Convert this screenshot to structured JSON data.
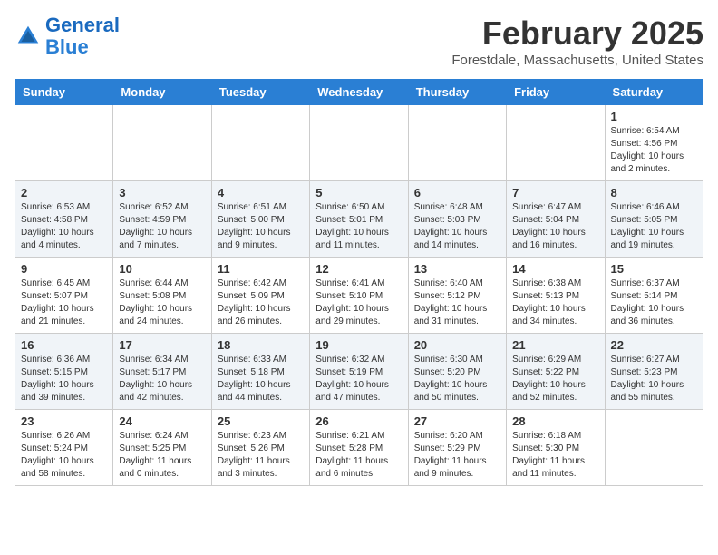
{
  "header": {
    "logo_line1": "General",
    "logo_line2": "Blue",
    "month": "February 2025",
    "location": "Forestdale, Massachusetts, United States"
  },
  "days_of_week": [
    "Sunday",
    "Monday",
    "Tuesday",
    "Wednesday",
    "Thursday",
    "Friday",
    "Saturday"
  ],
  "weeks": [
    {
      "shade": false,
      "days": [
        {
          "num": "",
          "info": ""
        },
        {
          "num": "",
          "info": ""
        },
        {
          "num": "",
          "info": ""
        },
        {
          "num": "",
          "info": ""
        },
        {
          "num": "",
          "info": ""
        },
        {
          "num": "",
          "info": ""
        },
        {
          "num": "1",
          "info": "Sunrise: 6:54 AM\nSunset: 4:56 PM\nDaylight: 10 hours and 2 minutes."
        }
      ]
    },
    {
      "shade": true,
      "days": [
        {
          "num": "2",
          "info": "Sunrise: 6:53 AM\nSunset: 4:58 PM\nDaylight: 10 hours and 4 minutes."
        },
        {
          "num": "3",
          "info": "Sunrise: 6:52 AM\nSunset: 4:59 PM\nDaylight: 10 hours and 7 minutes."
        },
        {
          "num": "4",
          "info": "Sunrise: 6:51 AM\nSunset: 5:00 PM\nDaylight: 10 hours and 9 minutes."
        },
        {
          "num": "5",
          "info": "Sunrise: 6:50 AM\nSunset: 5:01 PM\nDaylight: 10 hours and 11 minutes."
        },
        {
          "num": "6",
          "info": "Sunrise: 6:48 AM\nSunset: 5:03 PM\nDaylight: 10 hours and 14 minutes."
        },
        {
          "num": "7",
          "info": "Sunrise: 6:47 AM\nSunset: 5:04 PM\nDaylight: 10 hours and 16 minutes."
        },
        {
          "num": "8",
          "info": "Sunrise: 6:46 AM\nSunset: 5:05 PM\nDaylight: 10 hours and 19 minutes."
        }
      ]
    },
    {
      "shade": false,
      "days": [
        {
          "num": "9",
          "info": "Sunrise: 6:45 AM\nSunset: 5:07 PM\nDaylight: 10 hours and 21 minutes."
        },
        {
          "num": "10",
          "info": "Sunrise: 6:44 AM\nSunset: 5:08 PM\nDaylight: 10 hours and 24 minutes."
        },
        {
          "num": "11",
          "info": "Sunrise: 6:42 AM\nSunset: 5:09 PM\nDaylight: 10 hours and 26 minutes."
        },
        {
          "num": "12",
          "info": "Sunrise: 6:41 AM\nSunset: 5:10 PM\nDaylight: 10 hours and 29 minutes."
        },
        {
          "num": "13",
          "info": "Sunrise: 6:40 AM\nSunset: 5:12 PM\nDaylight: 10 hours and 31 minutes."
        },
        {
          "num": "14",
          "info": "Sunrise: 6:38 AM\nSunset: 5:13 PM\nDaylight: 10 hours and 34 minutes."
        },
        {
          "num": "15",
          "info": "Sunrise: 6:37 AM\nSunset: 5:14 PM\nDaylight: 10 hours and 36 minutes."
        }
      ]
    },
    {
      "shade": true,
      "days": [
        {
          "num": "16",
          "info": "Sunrise: 6:36 AM\nSunset: 5:15 PM\nDaylight: 10 hours and 39 minutes."
        },
        {
          "num": "17",
          "info": "Sunrise: 6:34 AM\nSunset: 5:17 PM\nDaylight: 10 hours and 42 minutes."
        },
        {
          "num": "18",
          "info": "Sunrise: 6:33 AM\nSunset: 5:18 PM\nDaylight: 10 hours and 44 minutes."
        },
        {
          "num": "19",
          "info": "Sunrise: 6:32 AM\nSunset: 5:19 PM\nDaylight: 10 hours and 47 minutes."
        },
        {
          "num": "20",
          "info": "Sunrise: 6:30 AM\nSunset: 5:20 PM\nDaylight: 10 hours and 50 minutes."
        },
        {
          "num": "21",
          "info": "Sunrise: 6:29 AM\nSunset: 5:22 PM\nDaylight: 10 hours and 52 minutes."
        },
        {
          "num": "22",
          "info": "Sunrise: 6:27 AM\nSunset: 5:23 PM\nDaylight: 10 hours and 55 minutes."
        }
      ]
    },
    {
      "shade": false,
      "days": [
        {
          "num": "23",
          "info": "Sunrise: 6:26 AM\nSunset: 5:24 PM\nDaylight: 10 hours and 58 minutes."
        },
        {
          "num": "24",
          "info": "Sunrise: 6:24 AM\nSunset: 5:25 PM\nDaylight: 11 hours and 0 minutes."
        },
        {
          "num": "25",
          "info": "Sunrise: 6:23 AM\nSunset: 5:26 PM\nDaylight: 11 hours and 3 minutes."
        },
        {
          "num": "26",
          "info": "Sunrise: 6:21 AM\nSunset: 5:28 PM\nDaylight: 11 hours and 6 minutes."
        },
        {
          "num": "27",
          "info": "Sunrise: 6:20 AM\nSunset: 5:29 PM\nDaylight: 11 hours and 9 minutes."
        },
        {
          "num": "28",
          "info": "Sunrise: 6:18 AM\nSunset: 5:30 PM\nDaylight: 11 hours and 11 minutes."
        },
        {
          "num": "",
          "info": ""
        }
      ]
    }
  ]
}
